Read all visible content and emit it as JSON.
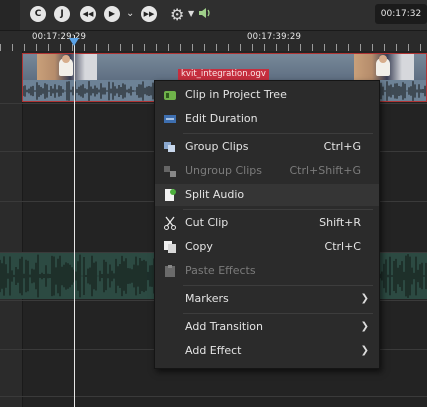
{
  "toolbar": {
    "buttons": [
      "C",
      "J",
      "◀◀",
      "▶",
      "▶▶"
    ],
    "timecode": "00:17:32"
  },
  "ruler": {
    "timecode_left": "00:17:29:29",
    "timecode_right": "00:17:39:29"
  },
  "clip": {
    "label": "kvit_integration.ogv"
  },
  "colors": {
    "clip_border": "#b03434",
    "clip_label_bg": "#c62e3e",
    "playhead_marker": "#5aa2e6",
    "menu_bg": "#2b2b2b",
    "audio_track_bg": "#2c4a42"
  },
  "menu": {
    "items": [
      {
        "label": "Clip in Project Tree",
        "shortcut": "",
        "icon": "clip-tree-icon",
        "disabled": false,
        "submenu": false
      },
      {
        "label": "Edit Duration",
        "shortcut": "",
        "icon": "duration-icon",
        "disabled": false,
        "submenu": false
      },
      {
        "label": "Group Clips",
        "shortcut": "Ctrl+G",
        "icon": "group-icon",
        "disabled": false,
        "submenu": false
      },
      {
        "label": "Ungroup Clips",
        "shortcut": "Ctrl+Shift+G",
        "icon": "ungroup-icon",
        "disabled": true,
        "submenu": false
      },
      {
        "label": "Split Audio",
        "shortcut": "",
        "icon": "split-audio-icon",
        "disabled": false,
        "submenu": false
      },
      {
        "label": "Cut Clip",
        "shortcut": "Shift+R",
        "icon": "scissors-icon",
        "disabled": false,
        "submenu": false
      },
      {
        "label": "Copy",
        "shortcut": "Ctrl+C",
        "icon": "copy-icon",
        "disabled": false,
        "submenu": false
      },
      {
        "label": "Paste Effects",
        "shortcut": "",
        "icon": "paste-icon",
        "disabled": true,
        "submenu": false
      },
      {
        "label": "Markers",
        "shortcut": "",
        "icon": "",
        "disabled": false,
        "submenu": true
      },
      {
        "label": "Add Transition",
        "shortcut": "",
        "icon": "",
        "disabled": false,
        "submenu": true
      },
      {
        "label": "Add Effect",
        "shortcut": "",
        "icon": "",
        "disabled": false,
        "submenu": true
      }
    ]
  }
}
